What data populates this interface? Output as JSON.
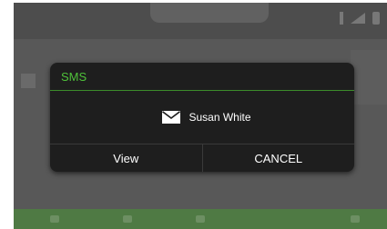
{
  "dialog": {
    "title": "SMS",
    "sender": "Susan White",
    "icon": "mail-icon",
    "view_label": "View",
    "cancel_label": "CANCEL"
  },
  "colors": {
    "title_green": "#4fc23a",
    "divider_green": "#3c8c2a",
    "dialog_bg": "#1e1e1e",
    "dim_overlay": "#585858"
  }
}
